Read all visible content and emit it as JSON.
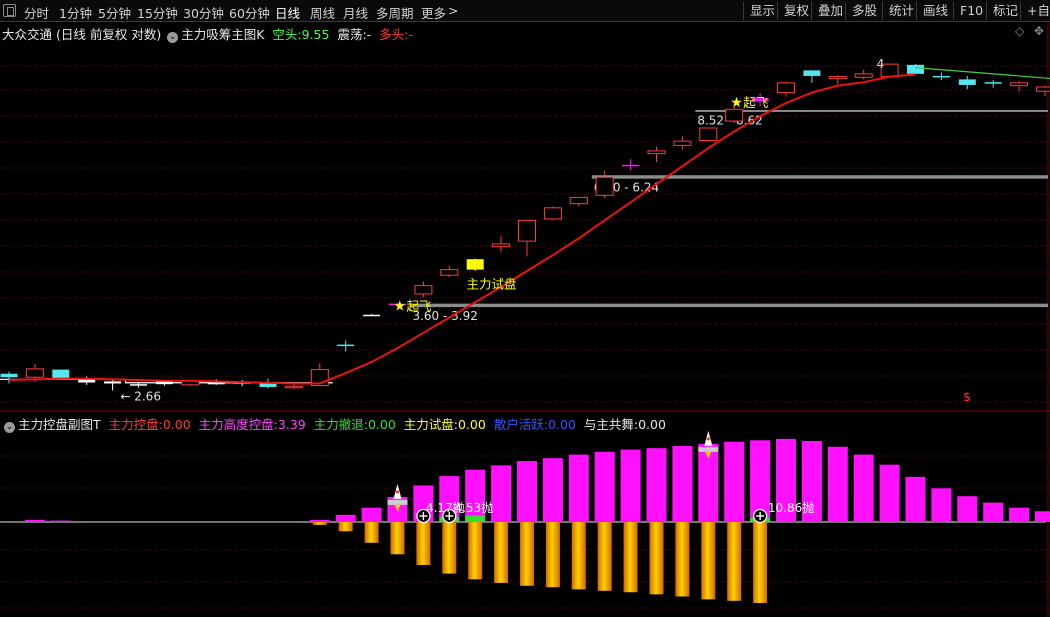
{
  "toolbar": {
    "timeframes": [
      "分时",
      "1分钟",
      "5分钟",
      "15分钟",
      "30分钟",
      "60分钟",
      "日线",
      "周线",
      "月线",
      "多周期",
      "更多"
    ],
    "active_timeframe": "日线",
    "more_arrow": ">",
    "right_buttons": [
      "显示",
      "复权",
      "叠加",
      "多股",
      "统计",
      "画线",
      "F10",
      "标记",
      "+自选"
    ]
  },
  "main_legend": {
    "stock": "大众交通",
    "mode": "(日线 前复权 对数)",
    "indicator": "主力吸筹主图K",
    "kong_tou_label": "空头:",
    "kong_tou_value": "9.55",
    "zhen_dang_label": "震荡:",
    "zhen_dang_value": "-",
    "duo_tou_label": "多头:",
    "duo_tou_value": "-",
    "diamond": "◇",
    "cross": "✥"
  },
  "sub_legend": {
    "indicator": "主力控盘副图T",
    "items": [
      {
        "label": "主力控盘:",
        "value": "0.00",
        "color": "#ff3a3a"
      },
      {
        "label": "主力高度控盘:",
        "value": "3.39",
        "color": "#ff44ff"
      },
      {
        "label": "主力撤退:",
        "value": "0.00",
        "color": "#33dd33"
      },
      {
        "label": "主力试盘:",
        "value": "0.00",
        "color": "#ffff33"
      },
      {
        "label": "散户活跃:",
        "value": "0.00",
        "color": "#3355ff"
      },
      {
        "label": "与主共舞:",
        "value": "0.00",
        "color": "#e8e8e8"
      }
    ]
  },
  "colors": {
    "up": "#ff3c3c",
    "down": "#55e6ee",
    "flat": "#ffffff",
    "ma": "#ee1111",
    "trend": "#44cc44",
    "zone": "#8c8c8c",
    "magenta": "#ff11ff",
    "yellow": "#ffff00",
    "grid": "#5a0000"
  },
  "chart_data": {
    "type": "candlestick",
    "candles": [
      {
        "o": 1.0,
        "h": 1.4,
        "l": 0.55,
        "c": 1.25,
        "color": "down"
      },
      {
        "o": 1.0,
        "h": 1.95,
        "l": 0.65,
        "c": 1.6,
        "color": "up"
      },
      {
        "o": 1.55,
        "h": 1.55,
        "l": 0.9,
        "c": 0.9,
        "color": "down"
      },
      {
        "o": 0.85,
        "h": 1.05,
        "l": 0.45,
        "c": 0.62,
        "color": "flat"
      },
      {
        "o": 0.7,
        "h": 0.85,
        "l": 0.05,
        "c": 0.55,
        "color": "flat"
      },
      {
        "o": 0.5,
        "h": 0.65,
        "l": 0.25,
        "c": 0.5,
        "color": "flat"
      },
      {
        "o": 0.5,
        "h": 0.8,
        "l": 0.4,
        "c": 0.7,
        "color": "flat"
      },
      {
        "o": 0.45,
        "h": 0.7,
        "l": 0.35,
        "c": 0.75,
        "color": "up"
      },
      {
        "o": 0.55,
        "h": 0.85,
        "l": 0.45,
        "c": 0.6,
        "color": "flat"
      },
      {
        "o": 0.6,
        "h": 0.8,
        "l": 0.35,
        "c": 0.65,
        "color": "flat"
      },
      {
        "o": 0.6,
        "h": 0.9,
        "l": 0.2,
        "c": 0.3,
        "color": "down"
      },
      {
        "o": 0.3,
        "h": 0.5,
        "l": 0.15,
        "c": 0.35,
        "color": "up"
      },
      {
        "o": 0.4,
        "h": 2.0,
        "l": 0.35,
        "c": 1.55,
        "color": "up"
      },
      {
        "o": 3.35,
        "h": 3.65,
        "l": 2.85,
        "c": 3.35,
        "color": "down"
      },
      {
        "o": 5.5,
        "h": 5.55,
        "l": 5.45,
        "c": 5.5,
        "color": "flat"
      },
      {
        "o": 6.2,
        "h": 6.35,
        "l": 6.1,
        "c": 6.3,
        "color": "magenta"
      },
      {
        "o": 7.0,
        "h": 7.9,
        "l": 6.75,
        "c": 7.6,
        "color": "up"
      },
      {
        "o": 8.35,
        "h": 9.05,
        "l": 8.2,
        "c": 8.75,
        "color": "up"
      },
      {
        "o": 9.5,
        "h": 9.55,
        "l": 8.65,
        "c": 8.75,
        "color": "yellow"
      },
      {
        "o": 10.4,
        "h": 11.2,
        "l": 10.0,
        "c": 10.6,
        "color": "up"
      },
      {
        "o": 10.8,
        "h": 12.3,
        "l": 9.7,
        "c": 12.3,
        "color": "up"
      },
      {
        "o": 12.4,
        "h": 13.3,
        "l": 12.3,
        "c": 13.2,
        "color": "up"
      },
      {
        "o": 13.5,
        "h": 14.0,
        "l": 13.3,
        "c": 13.95,
        "color": "up"
      },
      {
        "o": 14.1,
        "h": 15.9,
        "l": 13.9,
        "c": 15.4,
        "color": "up"
      },
      {
        "o": 16.3,
        "h": 16.7,
        "l": 15.9,
        "c": 16.2,
        "color": "magenta"
      },
      {
        "o": 17.1,
        "h": 17.6,
        "l": 16.5,
        "c": 17.3,
        "color": "up"
      },
      {
        "o": 17.7,
        "h": 18.35,
        "l": 17.4,
        "c": 18.0,
        "color": "up"
      },
      {
        "o": 18.05,
        "h": 18.95,
        "l": 18.0,
        "c": 18.95,
        "color": "up"
      },
      {
        "o": 19.45,
        "h": 20.5,
        "l": 19.3,
        "c": 20.3,
        "color": "up"
      },
      {
        "o": 20.85,
        "h": 21.45,
        "l": 20.5,
        "c": 21.1,
        "color": "magenta"
      },
      {
        "o": 21.5,
        "h": 22.3,
        "l": 21.2,
        "c": 22.2,
        "color": "up"
      },
      {
        "o": 22.7,
        "h": 23.1,
        "l": 22.2,
        "c": 23.1,
        "color": "down"
      },
      {
        "o": 22.5,
        "h": 22.75,
        "l": 22.1,
        "c": 22.65,
        "color": "up"
      },
      {
        "o": 22.6,
        "h": 23.15,
        "l": 22.45,
        "c": 22.85,
        "color": "up"
      },
      {
        "o": 22.65,
        "h": 23.55,
        "l": 22.6,
        "c": 23.55,
        "color": "up"
      },
      {
        "o": 23.5,
        "h": 23.55,
        "l": 22.85,
        "c": 22.85,
        "color": "down"
      },
      {
        "o": 22.7,
        "h": 22.95,
        "l": 22.4,
        "c": 22.7,
        "color": "down"
      },
      {
        "o": 22.45,
        "h": 22.7,
        "l": 21.75,
        "c": 22.05,
        "color": "down"
      },
      {
        "o": 22.25,
        "h": 22.4,
        "l": 21.85,
        "c": 22.15,
        "color": "down"
      },
      {
        "o": 22.0,
        "h": 22.35,
        "l": 21.6,
        "c": 22.2,
        "color": "up"
      },
      {
        "o": 21.6,
        "h": 22.0,
        "l": 21.25,
        "c": 21.9,
        "color": "up"
      },
      {
        "o": 21.7,
        "h": 22.0,
        "l": 21.45,
        "c": 21.9,
        "color": "up"
      },
      {
        "o": 21.55,
        "h": 21.95,
        "l": 20.95,
        "c": 21.8,
        "color": "up"
      }
    ],
    "ma_line": [
      0.8,
      0.85,
      0.9,
      0.9,
      0.85,
      0.8,
      0.75,
      0.75,
      0.7,
      0.65,
      0.6,
      0.55,
      0.55,
      1.3,
      2.1,
      3.1,
      4.2,
      5.3,
      6.4,
      7.5,
      8.65,
      9.8,
      11.0,
      12.3,
      13.6,
      14.9,
      16.2,
      17.5,
      18.7,
      19.8,
      20.75,
      21.5,
      22.0,
      22.25,
      22.65,
      22.8,
      null,
      null,
      null,
      null,
      null,
      null,
      null
    ],
    "resistance_line": [
      0.85,
      0.85,
      0.85,
      0.85,
      0.85,
      0.6,
      0.6,
      0.6,
      0.6,
      0.6,
      0.6,
      0.6,
      0.6,
      null,
      null,
      null,
      null,
      null,
      null,
      null,
      null,
      null,
      null,
      null,
      null,
      null,
      null,
      null,
      null,
      null,
      null,
      null,
      null,
      null,
      null,
      null,
      null,
      null,
      null,
      null,
      null,
      null,
      null
    ],
    "trend_line": {
      "from": [
        35,
        23.3
      ],
      "to": [
        42,
        22.25
      ]
    },
    "zones": [
      {
        "label": "3.60 - 3.92",
        "start": 15.5,
        "low": 6.05,
        "high": 6.3
      },
      {
        "label": "6.00 - 6.24",
        "start": 22.5,
        "low": 15.3,
        "high": 15.55
      },
      {
        "label": "8.52 - 8.62",
        "start": 26.5,
        "low": 20.15,
        "high": 20.25
      }
    ],
    "signals": [
      {
        "label": "起飞",
        "index": 15,
        "price": 6.1
      },
      {
        "label": "主力试盘",
        "index": 18.4,
        "price": 7.9
      },
      {
        "label": "起飞",
        "index": 28,
        "price": 20.75
      }
    ],
    "low_label": {
      "text": "2.66",
      "index": 4.3,
      "price": 0.05
    },
    "high_label": {
      "text": "4",
      "index": 33.5,
      "price": 23.55
    },
    "dollar_mark": {
      "text": "$",
      "index": 37,
      "price": -0.7
    },
    "ylim": [
      -1.0,
      25.0
    ],
    "sub": {
      "magenta": [
        0,
        0.3,
        0.2,
        0,
        0,
        0,
        0,
        0,
        0,
        0,
        0,
        0,
        0.3,
        1.0,
        2.0,
        3.5,
        5.1,
        6.4,
        7.3,
        7.9,
        8.5,
        8.9,
        9.4,
        9.8,
        10.1,
        10.3,
        10.6,
        10.9,
        11.2,
        11.4,
        11.6,
        11.3,
        10.5,
        9.4,
        8.0,
        6.3,
        4.7,
        3.6,
        2.7,
        2.0,
        1.5,
        1.0,
        0.7
      ],
      "orange": [
        0,
        0,
        0,
        0,
        0,
        0,
        0,
        0,
        0,
        0,
        0,
        0,
        0.4,
        1.3,
        2.9,
        4.5,
        6.0,
        7.2,
        8.0,
        8.5,
        8.9,
        9.1,
        9.4,
        9.6,
        9.8,
        10.1,
        10.4,
        10.8,
        11.0,
        11.3,
        0,
        0,
        0,
        0,
        0,
        0,
        0,
        0,
        0,
        0,
        0,
        0,
        0
      ],
      "green": [
        0,
        0,
        0,
        0,
        0,
        0,
        0,
        0,
        0,
        0,
        0,
        0,
        0,
        0,
        0,
        0,
        0,
        0.6,
        0.8,
        0,
        0,
        0,
        0,
        0,
        0,
        0,
        0,
        0,
        0,
        0.5,
        0,
        0,
        0,
        0,
        0,
        0,
        0,
        0,
        0,
        0,
        0,
        0,
        0
      ],
      "rockets": [
        15,
        27
      ],
      "plus_markers": [
        16,
        17,
        29
      ],
      "labels": [
        {
          "text": "4.17抛",
          "index": 16.1
        },
        {
          "text": "4.53抛",
          "index": 17.2
        },
        {
          "text": "10.86抛",
          "index": 29.3
        }
      ],
      "ylim": [
        -12,
        12
      ]
    }
  }
}
